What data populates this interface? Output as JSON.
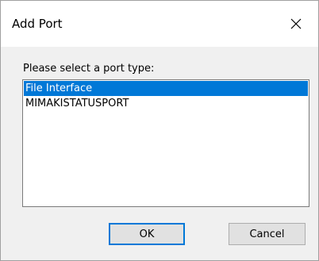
{
  "window": {
    "title": "Add Port",
    "close_icon": "close-icon"
  },
  "prompt": "Please select a port type:",
  "port_types": [
    {
      "label": "File Interface",
      "selected": true
    },
    {
      "label": "MIMAKISTATUSPORT",
      "selected": false
    }
  ],
  "buttons": {
    "ok_label": "OK",
    "cancel_label": "Cancel"
  },
  "colors": {
    "selection": "#0078d7",
    "dialog_bg": "#f0f0f0",
    "titlebar_bg": "#ffffff",
    "button_bg": "#e1e1e1"
  }
}
